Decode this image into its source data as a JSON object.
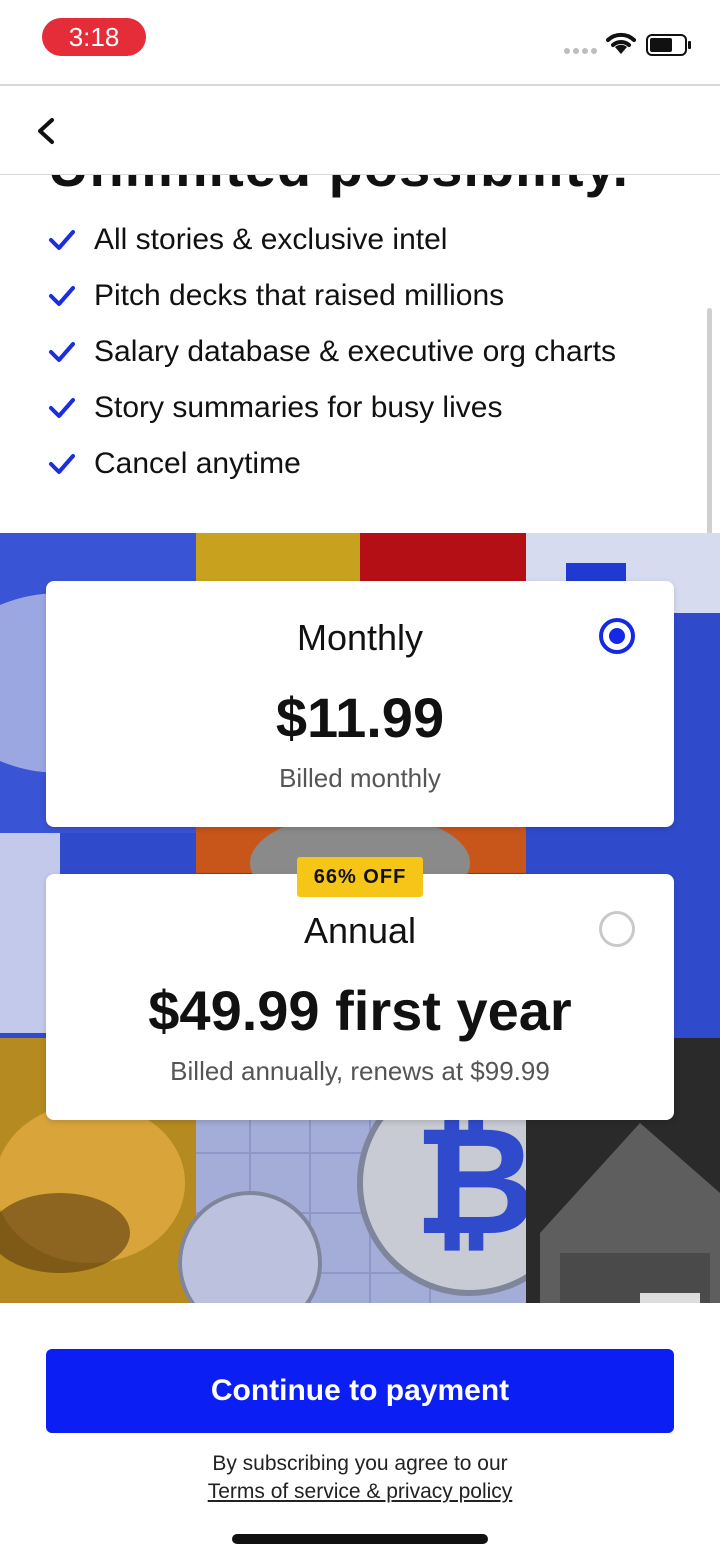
{
  "status_bar": {
    "time": "3:18",
    "wifi_icon": "wifi-icon",
    "battery_icon": "battery-icon"
  },
  "header": {
    "back_icon": "chevron-left-icon"
  },
  "hero": {
    "clipped_heading": "Unlimited possibility."
  },
  "features": [
    "All stories & exclusive intel",
    "Pitch decks that raised millions",
    "Salary database & executive org charts",
    "Story summaries for busy lives",
    "Cancel anytime"
  ],
  "plans": {
    "monthly": {
      "name": "Monthly",
      "price": "$11.99",
      "note": "Billed monthly",
      "selected": true
    },
    "annual": {
      "badge": "66% OFF",
      "name": "Annual",
      "price": "$49.99 first year",
      "note": "Billed annually, renews at $99.99",
      "selected": false
    }
  },
  "cta": {
    "label": "Continue to payment"
  },
  "legal": {
    "line1": "By subscribing you agree to our",
    "link": "Terms of service & privacy policy"
  },
  "colors": {
    "accent": "#0b1ff5",
    "badge": "#f5c518",
    "check": "#1a2ee0",
    "time_pill": "#e52d3a"
  }
}
